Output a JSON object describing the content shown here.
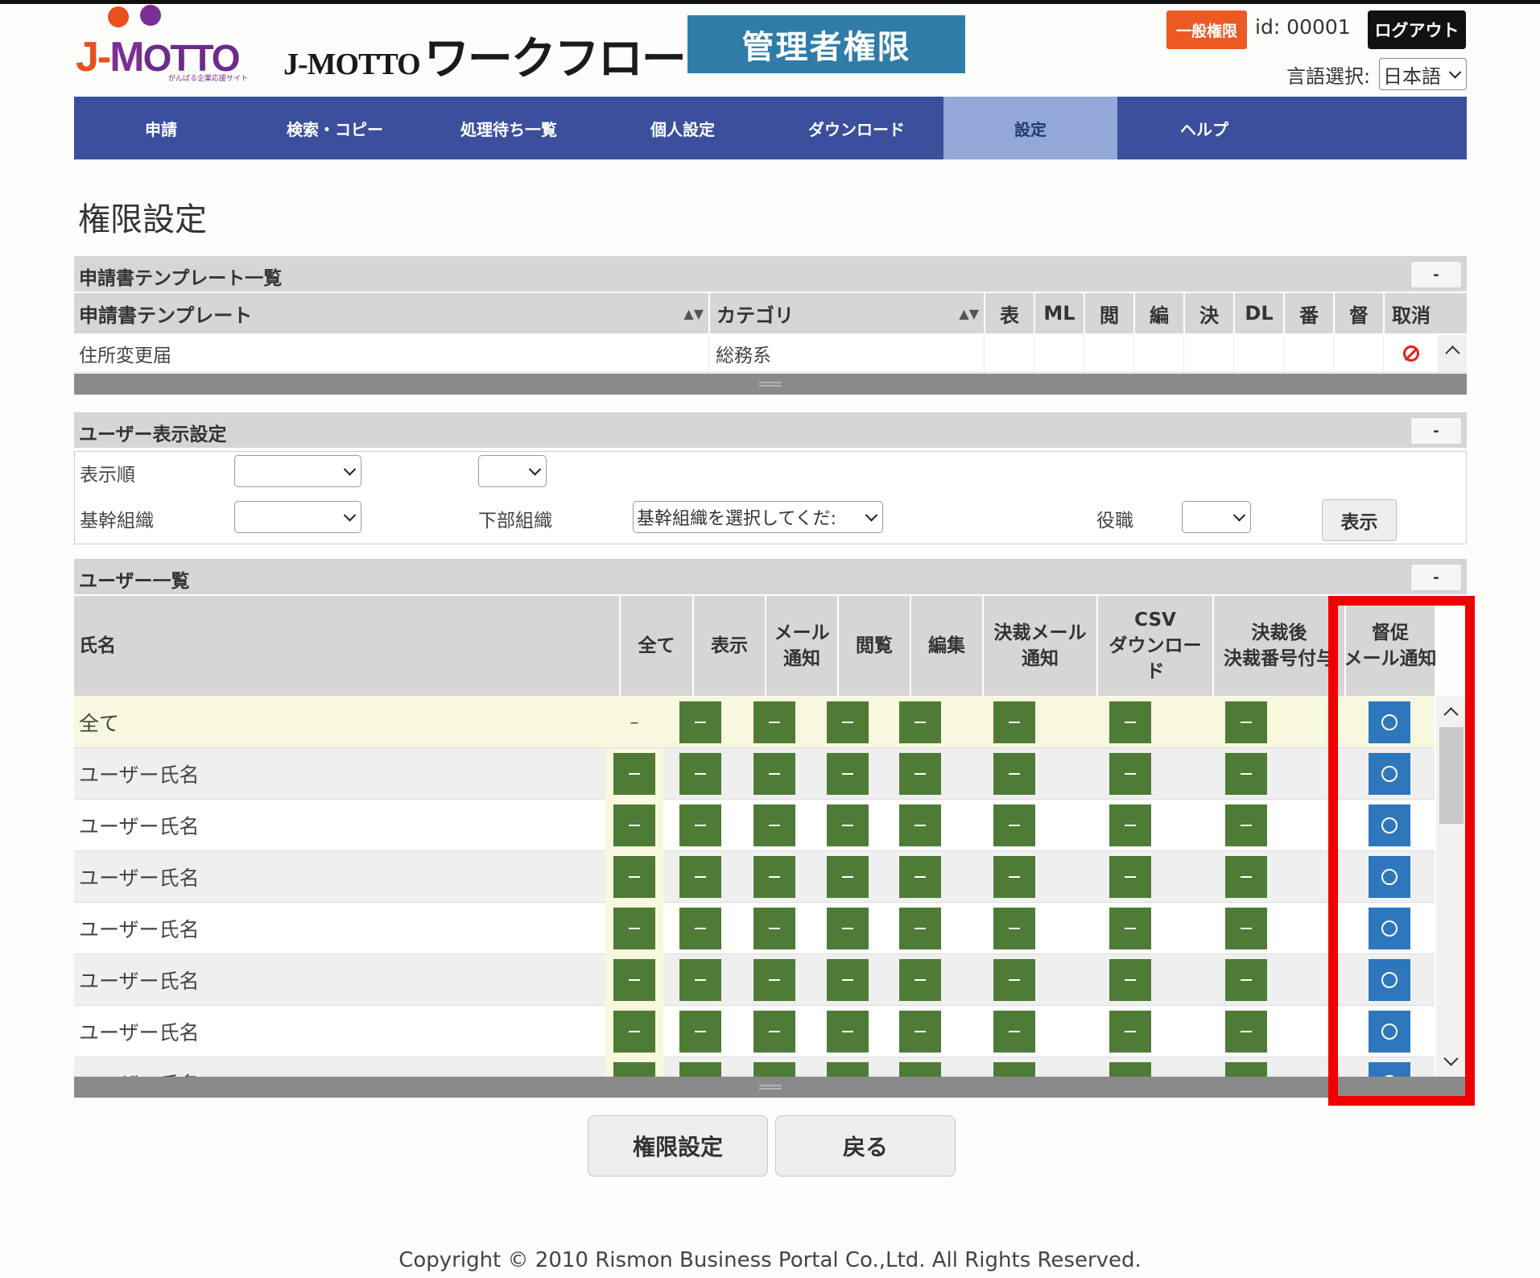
{
  "header": {
    "logo_text": "J-MOTTO",
    "logo_tagline": "がんばる企業応援サイト",
    "brand_en": "J-MOTTO",
    "brand_jp": "ワークフロー",
    "admin_banner": "管理者権限",
    "general_permission_label": "一般権限",
    "user_id": "id: 00001",
    "logout_label": "ログアウト",
    "language_label": "言語選択:",
    "language_value": "日本語"
  },
  "nav": {
    "items": [
      "申請",
      "検索・コピー",
      "処理待ち一覧",
      "個人設定",
      "ダウンロード",
      "設定",
      "ヘルプ"
    ],
    "active_index": 5
  },
  "page_title": "権限設定",
  "template_section": {
    "title": "申請書テンプレート一覧",
    "collapse_label": "-",
    "columns": [
      "申請書テンプレート",
      "カテゴリ",
      "表",
      "ML",
      "閲",
      "編",
      "決",
      "DL",
      "番",
      "督",
      "取消"
    ],
    "rows": [
      {
        "template": "住所変更届",
        "category": "総務系"
      }
    ]
  },
  "display_section": {
    "title": "ユーザー表示設定",
    "collapse_label": "-",
    "order_label": "表示順",
    "org_label": "基幹組織",
    "suborg_label": "下部組織",
    "suborg_placeholder": "基幹組織を選択してくだ:",
    "position_label": "役職",
    "show_button": "表示"
  },
  "user_section": {
    "title": "ユーザー一覧",
    "collapse_label": "-",
    "columns": {
      "name": "氏名",
      "all": "全て",
      "display": "表示",
      "mail_1": "メール",
      "mail_2": "通知",
      "browse": "閲覧",
      "edit": "編集",
      "approval_mail_1": "決裁メール",
      "approval_mail_2": "通知",
      "csv_1": "CSV",
      "csv_2": "ダウンロー",
      "csv_3": "ド",
      "post_approval_1": "決裁後",
      "post_approval_2": "決裁番号付与",
      "reminder_1": "督促",
      "reminder_2": "メール通知"
    },
    "all_row_label": "全て",
    "all_row_dash": "–",
    "user_rows": [
      "ユーザー氏名",
      "ユーザー氏名",
      "ユーザー氏名",
      "ユーザー氏名",
      "ユーザー氏名",
      "ユーザー氏名",
      "ユーザー氏名"
    ]
  },
  "actions": {
    "set_permission": "権限設定",
    "back": "戻る"
  },
  "footer": {
    "copyright": "Copyright © 2010 Rismon Business Portal Co.,Ltd. All Rights Reserved."
  },
  "colors": {
    "nav_bg": "#3b4f9c",
    "nav_active": "#93a8d6",
    "admin_banner": "#2f7ca8",
    "general_badge": "#ec5a23",
    "perm_on": "#4e7c36",
    "reminder_on": "#2f77bd",
    "highlight": "#ee0000"
  }
}
